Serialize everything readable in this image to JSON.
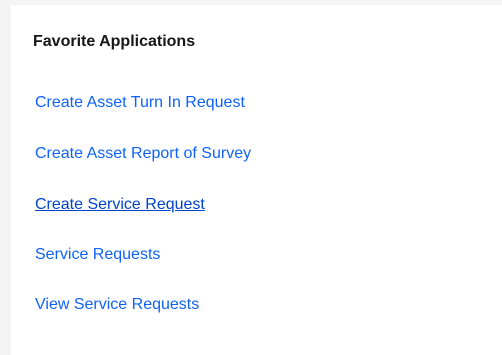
{
  "favorites": {
    "title": "Favorite Applications",
    "links": [
      {
        "label": "Create Asset Turn In Request"
      },
      {
        "label": "Create Asset Report of Survey"
      },
      {
        "label": "Create Service Request"
      },
      {
        "label": "Service Requests"
      },
      {
        "label": "View Service Requests"
      }
    ],
    "link_color": "#0f62fe",
    "hovered_link_color": "#0043ce",
    "title_color": "#161616"
  }
}
